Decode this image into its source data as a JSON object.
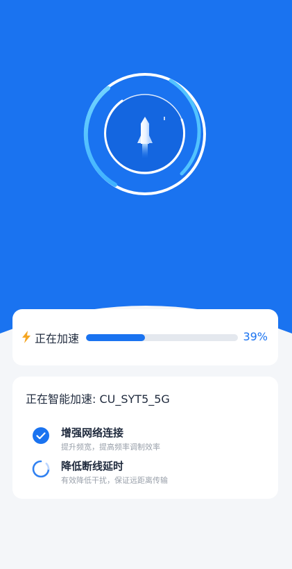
{
  "colors": {
    "hero_blue": "#1a73f0",
    "accent_blue": "#1a73f0",
    "light_cyan": "#52c3ff",
    "bolt_orange": "#f5a623",
    "background": "#f4f6f9"
  },
  "hero": {
    "icon": "rocket-icon"
  },
  "progress": {
    "label": "正在加速",
    "percent_text": "39%",
    "value": 0.39,
    "icon": "lightning-bolt-icon"
  },
  "status": {
    "title": "正在智能加速: CU_SYT5_5G",
    "tasks": [
      {
        "title": "增强网络连接",
        "subtitle": "提升频宽，提高频率调制效率",
        "state": "done",
        "icon": "check-circle-icon"
      },
      {
        "title": "降低断线延时",
        "subtitle": "有效降低干扰，保证远距离传输",
        "state": "in-progress",
        "icon": "spinner-icon"
      }
    ]
  }
}
